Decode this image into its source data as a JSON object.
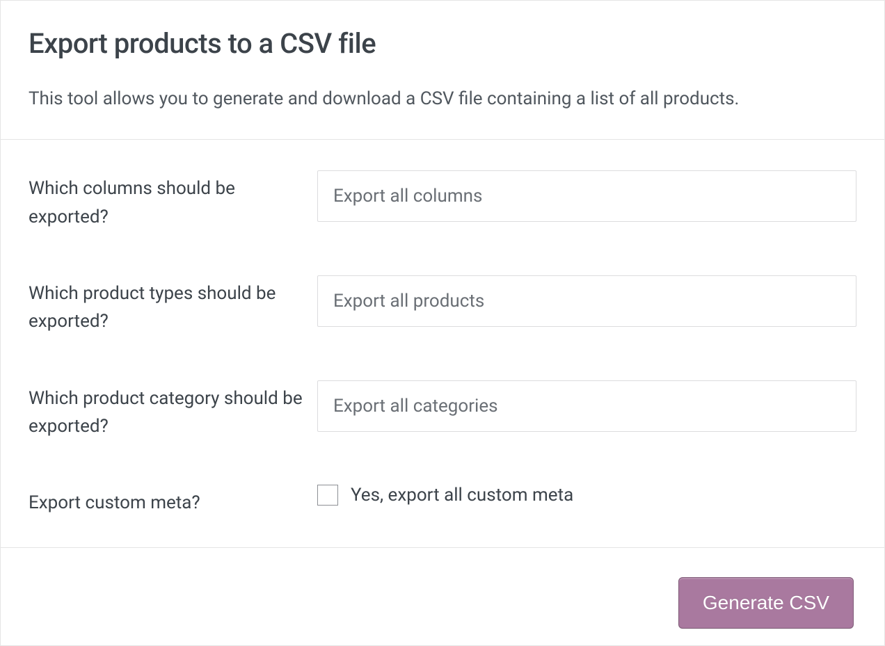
{
  "header": {
    "title": "Export products to a CSV file",
    "description": "This tool allows you to generate and download a CSV file containing a list of all products."
  },
  "form": {
    "columns": {
      "label": "Which columns should be exported?",
      "placeholder": "Export all columns"
    },
    "product_types": {
      "label": "Which product types should be exported?",
      "placeholder": "Export all products"
    },
    "categories": {
      "label": "Which product category should be exported?",
      "placeholder": "Export all categories"
    },
    "custom_meta": {
      "label": "Export custom meta?",
      "checkbox_label": "Yes, export all custom meta"
    }
  },
  "footer": {
    "generate_label": "Generate CSV"
  }
}
